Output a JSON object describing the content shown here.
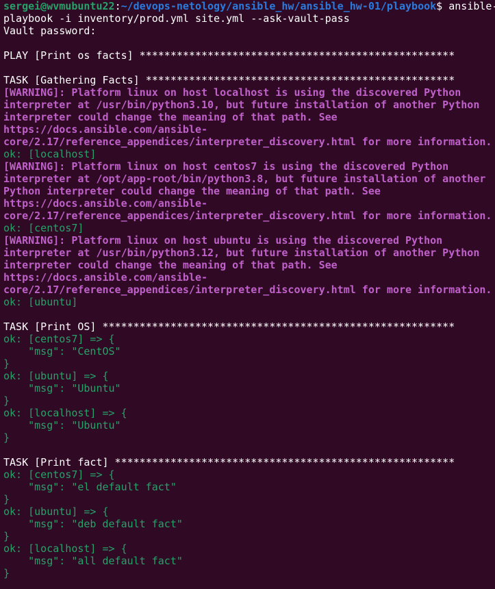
{
  "colors": {
    "background": "#300a24",
    "user_host": "#26a269",
    "cwd": "#2a7bde",
    "default_text": "#ffffff",
    "warning": "#c061cb",
    "ok": "#26a269"
  },
  "prompt": {
    "user_host": "sergei@wvmubuntu22",
    "separator": ":",
    "cwd": "~/devops-netology/ansible_hw/ansible_hw-01/playbook",
    "symbol": "$ ",
    "command_part1": "ansible-",
    "command_part2": "playbook -i inventory/prod.yml site.yml --ask-vault-pass"
  },
  "lines": {
    "vault": "Vault password:",
    "play": "PLAY [Print os facts] ***************************************************",
    "task_gather": "TASK [Gathering Facts] **************************************************",
    "w1_1": "[WARNING]: Platform linux on host localhost is using the discovered Python",
    "w1_2": "interpreter at /usr/bin/python3.10, but future installation of another Python",
    "w1_3": "interpreter could change the meaning of that path. See",
    "w1_4": "https://docs.ansible.com/ansible-",
    "w1_5": "core/2.17/reference_appendices/interpreter_discovery.html for more information.",
    "ok_localhost": "ok: [localhost]",
    "w2_1": "[WARNING]: Platform linux on host centos7 is using the discovered Python",
    "w2_2": "interpreter at /opt/app-root/bin/python3.8, but future installation of another",
    "w2_3": "Python interpreter could change the meaning of that path. See",
    "w2_4": "https://docs.ansible.com/ansible-",
    "w2_5": "core/2.17/reference_appendices/interpreter_discovery.html for more information.",
    "ok_centos7": "ok: [centos7]",
    "w3_1": "[WARNING]: Platform linux on host ubuntu is using the discovered Python",
    "w3_2": "interpreter at /usr/bin/python3.12, but future installation of another Python",
    "w3_3": "interpreter could change the meaning of that path. See",
    "w3_4": "https://docs.ansible.com/ansible-",
    "w3_5": "core/2.17/reference_appendices/interpreter_discovery.html for more information.",
    "ok_ubuntu": "ok: [ubuntu]",
    "task_os": "TASK [Print OS] *********************************************************",
    "os_c1": "ok: [centos7] => {",
    "os_c2": "    \"msg\": \"CentOS\"",
    "os_c3": "}",
    "os_u1": "ok: [ubuntu] => {",
    "os_u2": "    \"msg\": \"Ubuntu\"",
    "os_u3": "}",
    "os_l1": "ok: [localhost] => {",
    "os_l2": "    \"msg\": \"Ubuntu\"",
    "os_l3": "}",
    "task_fact": "TASK [Print fact] *******************************************************",
    "f_c1": "ok: [centos7] => {",
    "f_c2": "    \"msg\": \"el default fact\"",
    "f_c3": "}",
    "f_u1": "ok: [ubuntu] => {",
    "f_u2": "    \"msg\": \"deb default fact\"",
    "f_u3": "}",
    "f_l1": "ok: [localhost] => {",
    "f_l2": "    \"msg\": \"all default fact\"",
    "f_l3": "}"
  }
}
